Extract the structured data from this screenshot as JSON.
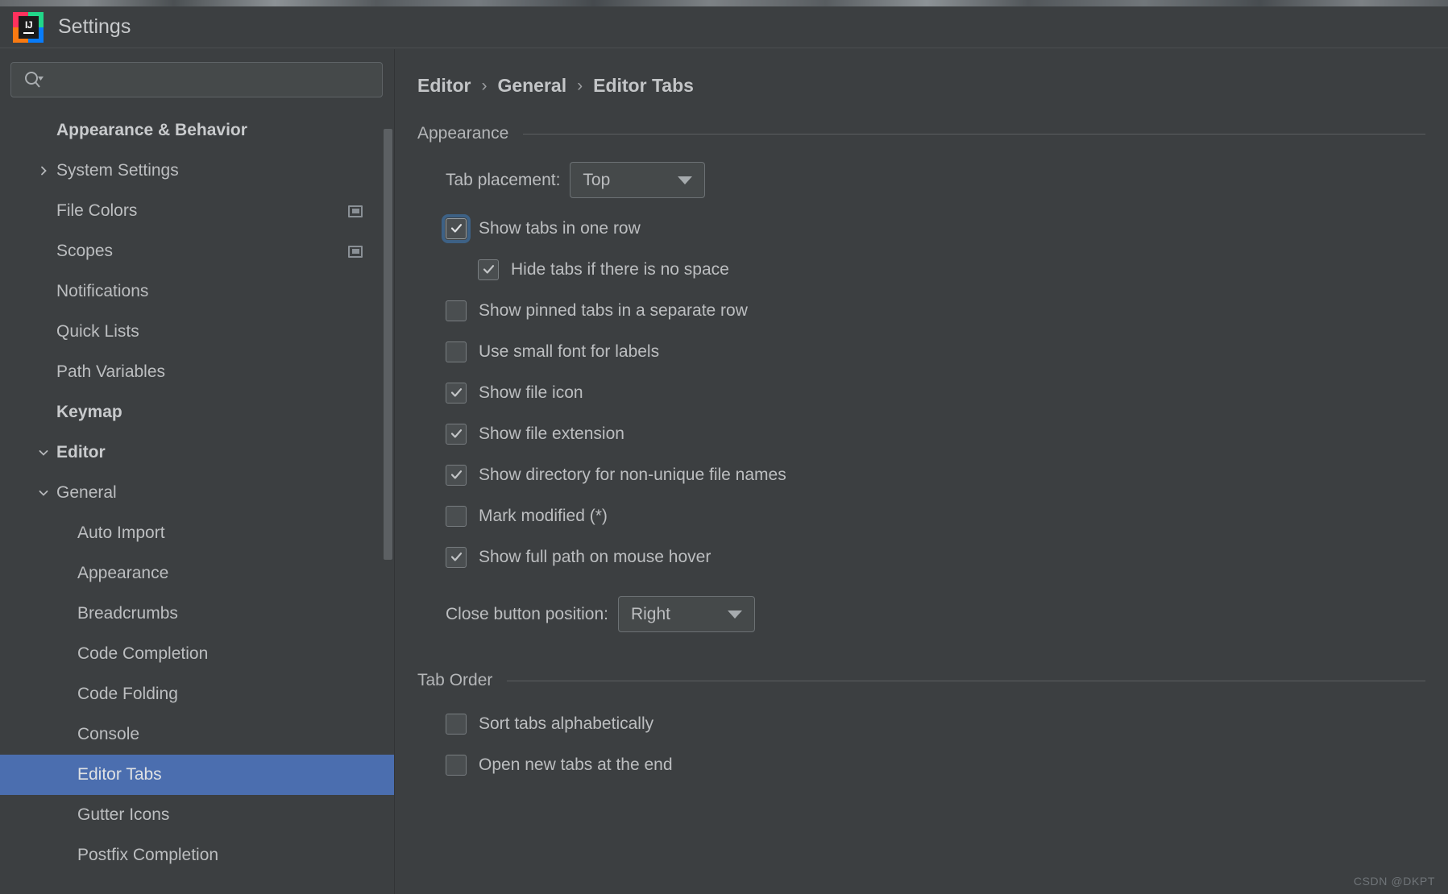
{
  "window": {
    "title": "Settings",
    "logo_icon": "intellij-idea-logo",
    "watermark": "CSDN @DKPT"
  },
  "search": {
    "placeholder": "",
    "value": "",
    "icon": "search-icon"
  },
  "sidebar": {
    "items": [
      {
        "label": "Appearance & Behavior",
        "indent": 0,
        "bold": true,
        "arrow": "none",
        "selected": false,
        "icon": null
      },
      {
        "label": "System Settings",
        "indent": 1,
        "bold": false,
        "arrow": "collapsed",
        "selected": false,
        "icon": null
      },
      {
        "label": "File Colors",
        "indent": 1,
        "bold": false,
        "arrow": "none",
        "selected": false,
        "icon": "window-frame-icon"
      },
      {
        "label": "Scopes",
        "indent": 1,
        "bold": false,
        "arrow": "none",
        "selected": false,
        "icon": "window-frame-icon"
      },
      {
        "label": "Notifications",
        "indent": 1,
        "bold": false,
        "arrow": "none",
        "selected": false,
        "icon": null
      },
      {
        "label": "Quick Lists",
        "indent": 1,
        "bold": false,
        "arrow": "none",
        "selected": false,
        "icon": null
      },
      {
        "label": "Path Variables",
        "indent": 1,
        "bold": false,
        "arrow": "none",
        "selected": false,
        "icon": null
      },
      {
        "label": "Keymap",
        "indent": 0,
        "bold": true,
        "arrow": "none",
        "selected": false,
        "icon": null
      },
      {
        "label": "Editor",
        "indent": 0,
        "bold": true,
        "arrow": "expanded",
        "selected": false,
        "icon": null
      },
      {
        "label": "General",
        "indent": 1,
        "bold": false,
        "arrow": "expanded",
        "selected": false,
        "icon": null
      },
      {
        "label": "Auto Import",
        "indent": 2,
        "bold": false,
        "arrow": "none",
        "selected": false,
        "icon": null
      },
      {
        "label": "Appearance",
        "indent": 2,
        "bold": false,
        "arrow": "none",
        "selected": false,
        "icon": null
      },
      {
        "label": "Breadcrumbs",
        "indent": 2,
        "bold": false,
        "arrow": "none",
        "selected": false,
        "icon": null
      },
      {
        "label": "Code Completion",
        "indent": 2,
        "bold": false,
        "arrow": "none",
        "selected": false,
        "icon": null
      },
      {
        "label": "Code Folding",
        "indent": 2,
        "bold": false,
        "arrow": "none",
        "selected": false,
        "icon": null
      },
      {
        "label": "Console",
        "indent": 2,
        "bold": false,
        "arrow": "none",
        "selected": false,
        "icon": null
      },
      {
        "label": "Editor Tabs",
        "indent": 2,
        "bold": false,
        "arrow": "none",
        "selected": true,
        "icon": null
      },
      {
        "label": "Gutter Icons",
        "indent": 2,
        "bold": false,
        "arrow": "none",
        "selected": false,
        "icon": null
      },
      {
        "label": "Postfix Completion",
        "indent": 2,
        "bold": false,
        "arrow": "none",
        "selected": false,
        "icon": null
      }
    ]
  },
  "breadcrumb": {
    "parts": [
      "Editor",
      "General",
      "Editor Tabs"
    ],
    "separator": "›"
  },
  "appearance": {
    "section_title": "Appearance",
    "tab_placement": {
      "label": "Tab placement:",
      "value": "Top"
    },
    "close_button_position": {
      "label": "Close button position:",
      "value": "Right"
    },
    "checkboxes": [
      {
        "label": "Show tabs in one row",
        "checked": true,
        "focused": true,
        "sub": false
      },
      {
        "label": "Hide tabs if there is no space",
        "checked": true,
        "focused": false,
        "sub": true
      },
      {
        "label": "Show pinned tabs in a separate row",
        "checked": false,
        "focused": false,
        "sub": false
      },
      {
        "label": "Use small font for labels",
        "checked": false,
        "focused": false,
        "sub": false
      },
      {
        "label": "Show file icon",
        "checked": true,
        "focused": false,
        "sub": false
      },
      {
        "label": "Show file extension",
        "checked": true,
        "focused": false,
        "sub": false
      },
      {
        "label": "Show directory for non-unique file names",
        "checked": true,
        "focused": false,
        "sub": false
      },
      {
        "label": "Mark modified (*)",
        "checked": false,
        "focused": false,
        "sub": false
      },
      {
        "label": "Show full path on mouse hover",
        "checked": true,
        "focused": false,
        "sub": false
      }
    ]
  },
  "tab_order": {
    "section_title": "Tab Order",
    "checkboxes": [
      {
        "label": "Sort tabs alphabetically",
        "checked": false,
        "focused": false,
        "sub": false
      },
      {
        "label": "Open new tabs at the end",
        "checked": false,
        "focused": false,
        "sub": false
      }
    ]
  },
  "colors": {
    "window_bg": "#3c3f41",
    "selection_blue": "#4b6eaf",
    "text": "#bcbec0",
    "border": "#6c7174"
  }
}
